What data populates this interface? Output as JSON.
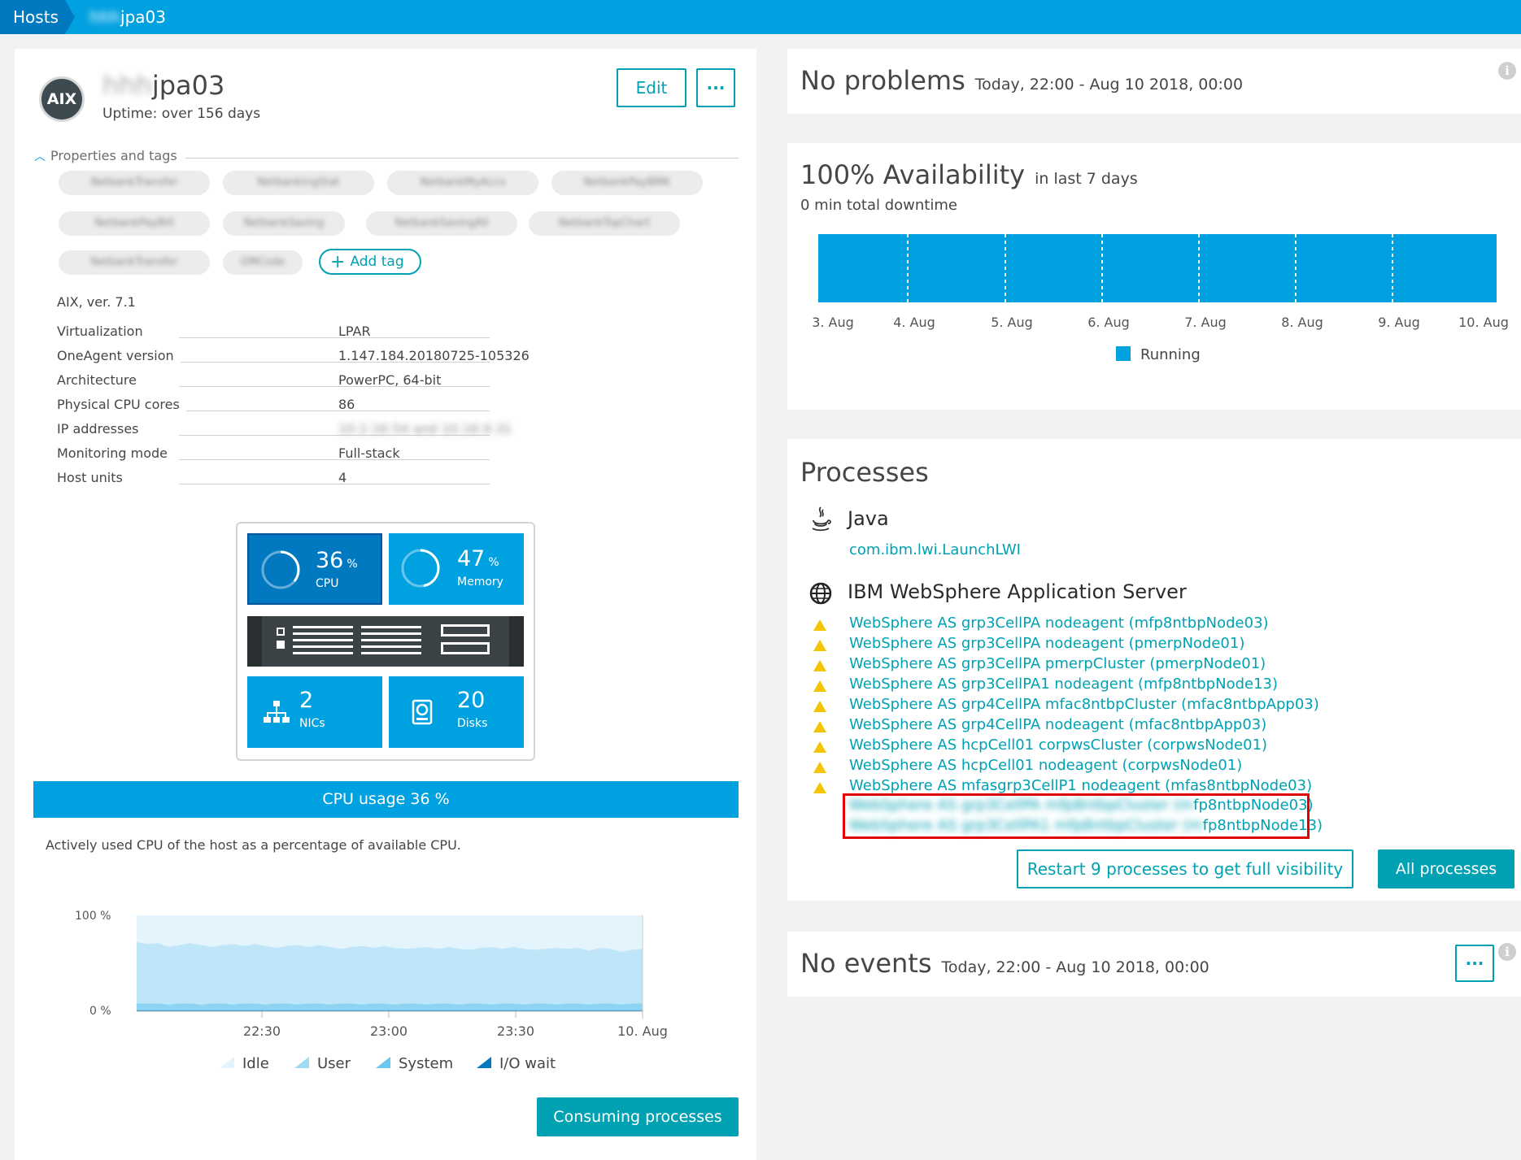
{
  "breadcrumb": {
    "root": "Hosts",
    "host_prefix": "hhh",
    "host_suffix": "jpa03"
  },
  "host": {
    "logo_text": "AIX",
    "name_prefix": "hhh",
    "name_suffix": "jpa03",
    "uptime": "Uptime: over 156 days",
    "edit_label": "Edit",
    "more_label": "···"
  },
  "properties": {
    "toggle_label": "Properties and tags",
    "tags": [
      "NetbankTransfer",
      "NetbankingStat",
      "NetbankMyAcco",
      "NetbankPayBMK",
      "NetbankPayBill",
      "NetbankSaving",
      "NetbankSavingAll",
      "NetbankTopChart",
      "NetbankTransfer",
      "OMCode"
    ],
    "add_tag_label": "Add tag",
    "os_version": "AIX, ver. 7.1",
    "rows": [
      {
        "key": "Virtualization",
        "value": "LPAR"
      },
      {
        "key": "OneAgent version",
        "value": "1.147.184.20180725-105326"
      },
      {
        "key": "Architecture",
        "value": "PowerPC, 64-bit"
      },
      {
        "key": "Physical CPU cores",
        "value": "86"
      },
      {
        "key": "IP addresses",
        "value": "10.2.16.54 and 10.16.9.31"
      },
      {
        "key": "Monitoring mode",
        "value": "Full-stack"
      },
      {
        "key": "Host units",
        "value": "4"
      }
    ]
  },
  "infographic": {
    "cpu_value": "36",
    "cpu_unit": "%",
    "cpu_label": "CPU",
    "cpu_fraction": 0.36,
    "memory_value": "47",
    "memory_unit": "%",
    "memory_label": "Memory",
    "memory_fraction": 0.47,
    "nics_value": "2",
    "nics_label": "NICs",
    "disks_value": "20",
    "disks_label": "Disks"
  },
  "cpu_section": {
    "bar_label": "CPU usage 36 %",
    "description": "Actively used CPU of the host as a percentage of available CPU.",
    "consuming_button": "Consuming processes"
  },
  "chart_data": {
    "type": "area",
    "y_tick_labels": [
      "100 %",
      "0 %"
    ],
    "x_tick_labels": [
      "22:30",
      "23:00",
      "23:30",
      "10. Aug"
    ],
    "ylim": [
      0,
      100
    ],
    "series": [
      {
        "name": "Idle",
        "color": "#e3f4fc"
      },
      {
        "name": "User",
        "color": "#bfe6f8",
        "values": [
          64,
          62,
          63,
          60,
          61,
          63,
          62,
          59,
          61,
          63,
          60,
          62,
          61,
          58,
          60,
          62,
          59,
          61,
          60,
          57,
          59,
          61,
          58,
          60,
          59,
          57,
          58,
          60,
          57,
          59,
          58,
          56,
          58,
          60,
          57,
          59,
          58,
          56,
          57,
          59,
          57,
          58,
          56,
          58,
          57,
          55,
          56,
          57
        ]
      },
      {
        "name": "System",
        "color": "#8dd3f2",
        "values": [
          7,
          7,
          7,
          6,
          7,
          7,
          6,
          7,
          7,
          6,
          7,
          7,
          6,
          7,
          7,
          6,
          7,
          7,
          6,
          7,
          7,
          6,
          7,
          7,
          6,
          7,
          7,
          6,
          7,
          7,
          6,
          7,
          7,
          6,
          7,
          7,
          6,
          7,
          7,
          6,
          7,
          7,
          6,
          7,
          7,
          6,
          7,
          7
        ]
      },
      {
        "name": "I/O wait",
        "color": "#0079c1",
        "values": [
          1,
          1,
          1,
          1,
          1,
          1,
          1,
          1,
          1,
          1,
          1,
          1,
          1,
          1,
          1,
          1,
          1,
          1,
          1,
          1,
          1,
          1,
          1,
          1,
          1,
          1,
          1,
          1,
          1,
          1,
          1,
          1,
          1,
          1,
          1,
          1,
          1,
          1,
          1,
          1,
          1,
          1,
          1,
          1,
          1,
          1,
          1,
          1
        ]
      }
    ],
    "legend": "bottom"
  },
  "problems": {
    "title": "No problems",
    "range": "Today, 22:00 - Aug 10 2018, 00:00",
    "info": "i"
  },
  "availability": {
    "title": "100% Availability",
    "period": "in last 7 days",
    "downtime": "0 min total downtime",
    "days": [
      "3. Aug",
      "4. Aug",
      "5. Aug",
      "6. Aug",
      "7. Aug",
      "8. Aug",
      "9. Aug",
      "10. Aug"
    ],
    "availability_percent": 100,
    "legend": "Running",
    "color": "#00a1e0"
  },
  "processes": {
    "title": "Processes",
    "java_group": "Java",
    "java_process": "com.ibm.lwi.LaunchLWI",
    "ws_group": "IBM WebSphere Application Server",
    "ws_processes": [
      "WebSphere AS grp3CellPA nodeagent (mfp8ntbpNode03)",
      "WebSphere AS grp3CellPA nodeagent (pmerpNode01)",
      "WebSphere AS grp3CellPA pmerpCluster (pmerpNode01)",
      "WebSphere AS grp3CellPA1 nodeagent (mfp8ntbpNode13)",
      "WebSphere AS grp4CellPA mfac8ntbpCluster (mfac8ntbpApp03)",
      "WebSphere AS grp4CellPA nodeagent (mfac8ntbpApp03)",
      "WebSphere AS hcpCell01 corpwsCluster (corpwsNode01)",
      "WebSphere AS hcpCell01 nodeagent (corpwsNode01)",
      "WebSphere AS mfasgrp3CellP1 nodeagent (mfas8ntbpNode03)"
    ],
    "hidden_processes": [
      {
        "blurred": "WebSphere AS grp3CellPA mfp8ntbpCluster (m",
        "visible": "fp8ntbpNode03)"
      },
      {
        "blurred": "WebSphere AS grp3CellPA1 mfp8ntbpCluster (m",
        "visible": "fp8ntbpNode13)"
      }
    ],
    "restart_button": "Restart 9 processes to get full visibility",
    "all_button": "All processes"
  },
  "events": {
    "title": "No events",
    "range": "Today, 22:00 - Aug 10 2018, 00:00",
    "more_label": "···",
    "info": "i"
  }
}
